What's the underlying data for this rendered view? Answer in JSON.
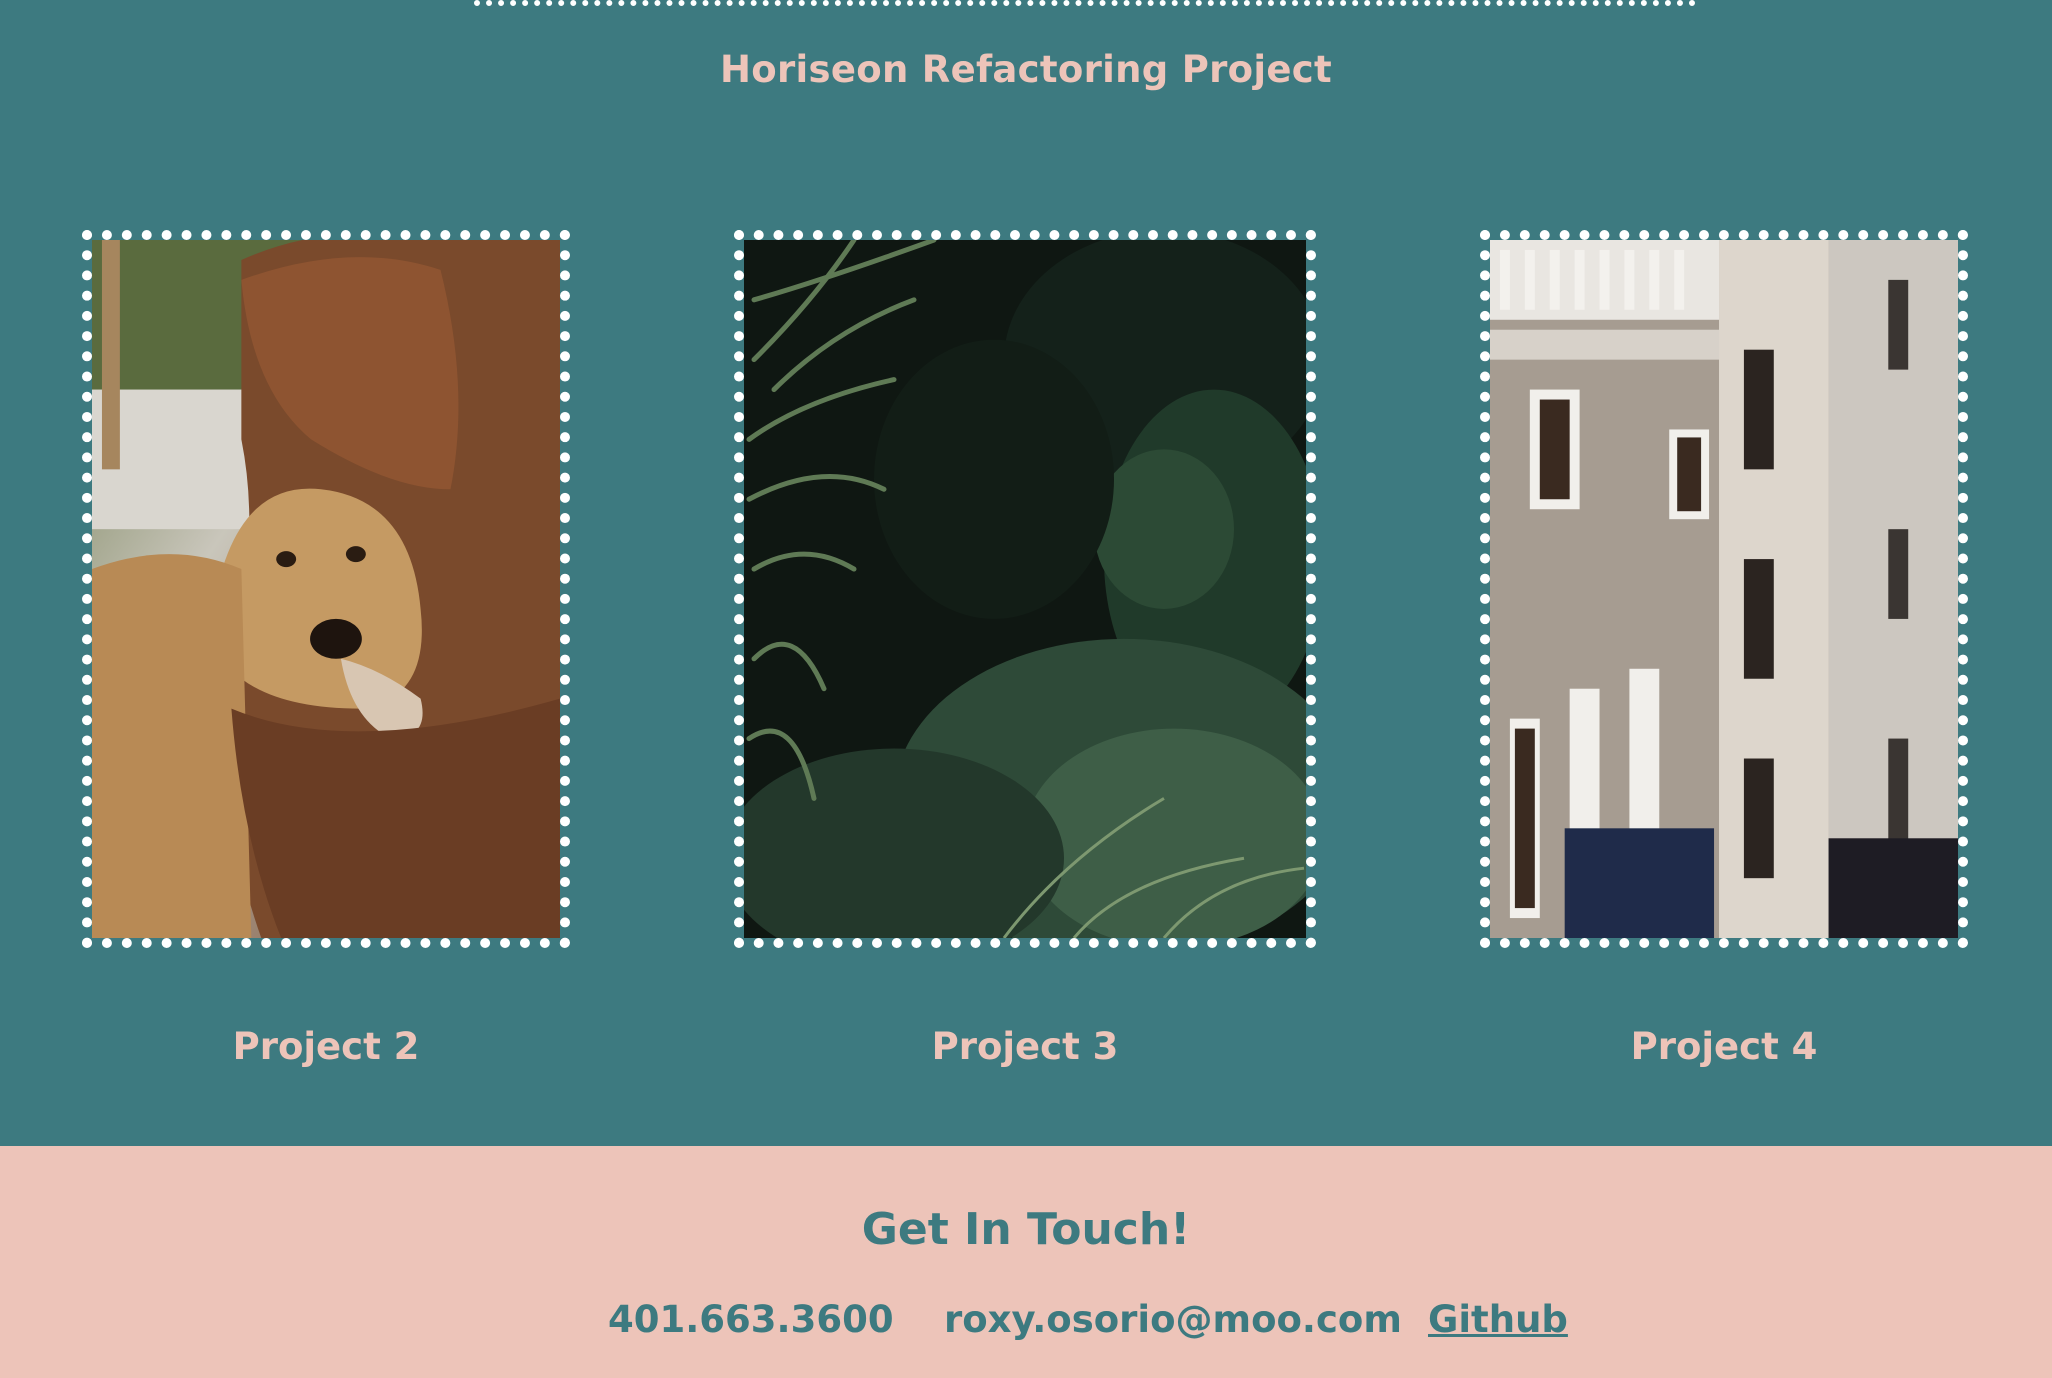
{
  "projects_section": {
    "title": "Horiseon Refactoring Project",
    "cards": [
      {
        "label": "Project 2",
        "image": "dog-hug-photo"
      },
      {
        "label": "Project 3",
        "image": "jungle-foliage-photo"
      },
      {
        "label": "Project 4",
        "image": "building-alley-photo"
      }
    ]
  },
  "contact": {
    "heading": "Get In Touch!",
    "phone": "401.663.3600",
    "email": "roxy.osorio@moo.com",
    "github": "Github"
  },
  "colors": {
    "teal": "#3d7a80",
    "pink": "#edc4b9",
    "border": "#ffffff"
  }
}
